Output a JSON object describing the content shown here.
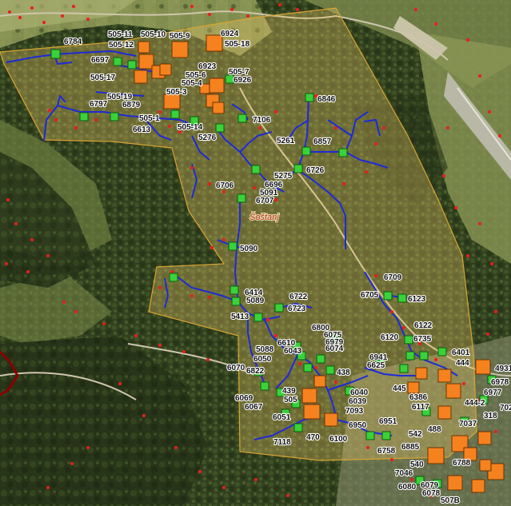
{
  "map": {
    "town_label": "Šoštanj",
    "colors": {
      "area_fill": "#e6c463",
      "area_border": "#d9a531",
      "pipe_line": "#1d2bd6",
      "station_green": "#3ad13a",
      "station_orange": "#f5821f",
      "house_dot": "#ee1c1c",
      "road": "#c9c4b8",
      "boundary_red": "#8b0000"
    },
    "labels": [
      {
        "id": "6784",
        "t": "6784"
      },
      {
        "id": "505-11",
        "t": "505-11"
      },
      {
        "id": "505-12",
        "t": "505-12"
      },
      {
        "id": "505-10",
        "t": "505-10"
      },
      {
        "id": "505-9",
        "t": "505-9"
      },
      {
        "id": "6924",
        "t": "6924"
      },
      {
        "id": "505-18",
        "t": "505-18"
      },
      {
        "id": "6697",
        "t": "6697"
      },
      {
        "id": "6923",
        "t": "6923"
      },
      {
        "id": "505-7",
        "t": "505-7"
      },
      {
        "id": "505-17",
        "t": "505-17"
      },
      {
        "id": "505-6",
        "t": "505-6"
      },
      {
        "id": "505-4",
        "t": "505-4"
      },
      {
        "id": "6926",
        "t": "6926"
      },
      {
        "id": "505-3",
        "t": "505-3"
      },
      {
        "id": "505-19",
        "t": "505-19"
      },
      {
        "id": "6797",
        "t": "6797"
      },
      {
        "id": "6879",
        "t": "6879"
      },
      {
        "id": "6846",
        "t": "6846"
      },
      {
        "id": "505-1",
        "t": "505-1"
      },
      {
        "id": "7106",
        "t": "7106"
      },
      {
        "id": "6613",
        "t": "6613"
      },
      {
        "id": "505-14",
        "t": "505-14"
      },
      {
        "id": "5276",
        "t": "5276"
      },
      {
        "id": "5261",
        "t": "5261"
      },
      {
        "id": "6857",
        "t": "6857"
      },
      {
        "id": "6726",
        "t": "6726"
      },
      {
        "id": "5275",
        "t": "5275"
      },
      {
        "id": "6706",
        "t": "6706"
      },
      {
        "id": "6696",
        "t": "6696"
      },
      {
        "id": "5091",
        "t": "5091"
      },
      {
        "id": "6707",
        "t": "6707"
      },
      {
        "id": "5090",
        "t": "5090"
      },
      {
        "id": "6709",
        "t": "6709"
      },
      {
        "id": "6414",
        "t": "6414"
      },
      {
        "id": "6722",
        "t": "6722"
      },
      {
        "id": "6705",
        "t": "6705"
      },
      {
        "id": "6123",
        "t": "6123"
      },
      {
        "id": "5089",
        "t": "5089"
      },
      {
        "id": "6723",
        "t": "6723"
      },
      {
        "id": "5413",
        "t": "5413"
      },
      {
        "id": "6122",
        "t": "6122"
      },
      {
        "id": "6800",
        "t": "6800"
      },
      {
        "id": "6075",
        "t": "6075"
      },
      {
        "id": "6120",
        "t": "6120"
      },
      {
        "id": "6735",
        "t": "6735"
      },
      {
        "id": "6610",
        "t": "6610"
      },
      {
        "id": "6979",
        "t": "6979"
      },
      {
        "id": "6043",
        "t": "6043"
      },
      {
        "id": "6074",
        "t": "6074"
      },
      {
        "id": "6401",
        "t": "6401"
      },
      {
        "id": "5088",
        "t": "5088"
      },
      {
        "id": "6941",
        "t": "6941"
      },
      {
        "id": "444",
        "t": "444"
      },
      {
        "id": "6050",
        "t": "6050"
      },
      {
        "id": "6625",
        "t": "6625"
      },
      {
        "id": "6070",
        "t": "6070"
      },
      {
        "id": "6822",
        "t": "6822"
      },
      {
        "id": "438",
        "t": "438"
      },
      {
        "id": "4931",
        "t": "4931"
      },
      {
        "id": "6978",
        "t": "6978"
      },
      {
        "id": "439",
        "t": "439"
      },
      {
        "id": "6040",
        "t": "6040"
      },
      {
        "id": "445",
        "t": "445"
      },
      {
        "id": "6977",
        "t": "6977"
      },
      {
        "id": "6069",
        "t": "6069"
      },
      {
        "id": "505",
        "t": "505"
      },
      {
        "id": "6039",
        "t": "6039"
      },
      {
        "id": "6386",
        "t": "6386"
      },
      {
        "id": "444-2",
        "t": "444-2"
      },
      {
        "id": "6067",
        "t": "6067"
      },
      {
        "id": "7093",
        "t": "7093"
      },
      {
        "id": "6117",
        "t": "6117"
      },
      {
        "id": "318",
        "t": "318"
      },
      {
        "id": "702",
        "t": "702"
      },
      {
        "id": "6051",
        "t": "6051"
      },
      {
        "id": "6951",
        "t": "6951"
      },
      {
        "id": "7037",
        "t": "7037"
      },
      {
        "id": "6950",
        "t": "6950"
      },
      {
        "id": "488",
        "t": "488"
      },
      {
        "id": "542",
        "t": "542"
      },
      {
        "id": "470",
        "t": "470"
      },
      {
        "id": "6100",
        "t": "6100"
      },
      {
        "id": "7118",
        "t": "7118"
      },
      {
        "id": "6885",
        "t": "6885"
      },
      {
        "id": "6758",
        "t": "6758"
      },
      {
        "id": "6788",
        "t": "6788"
      },
      {
        "id": "540",
        "t": "540"
      },
      {
        "id": "7046",
        "t": "7046"
      },
      {
        "id": "6078",
        "t": "6078"
      },
      {
        "id": "6080",
        "t": "6080"
      },
      {
        "id": "6079",
        "t": "6079"
      },
      {
        "id": "507B",
        "t": "507B"
      }
    ]
  }
}
